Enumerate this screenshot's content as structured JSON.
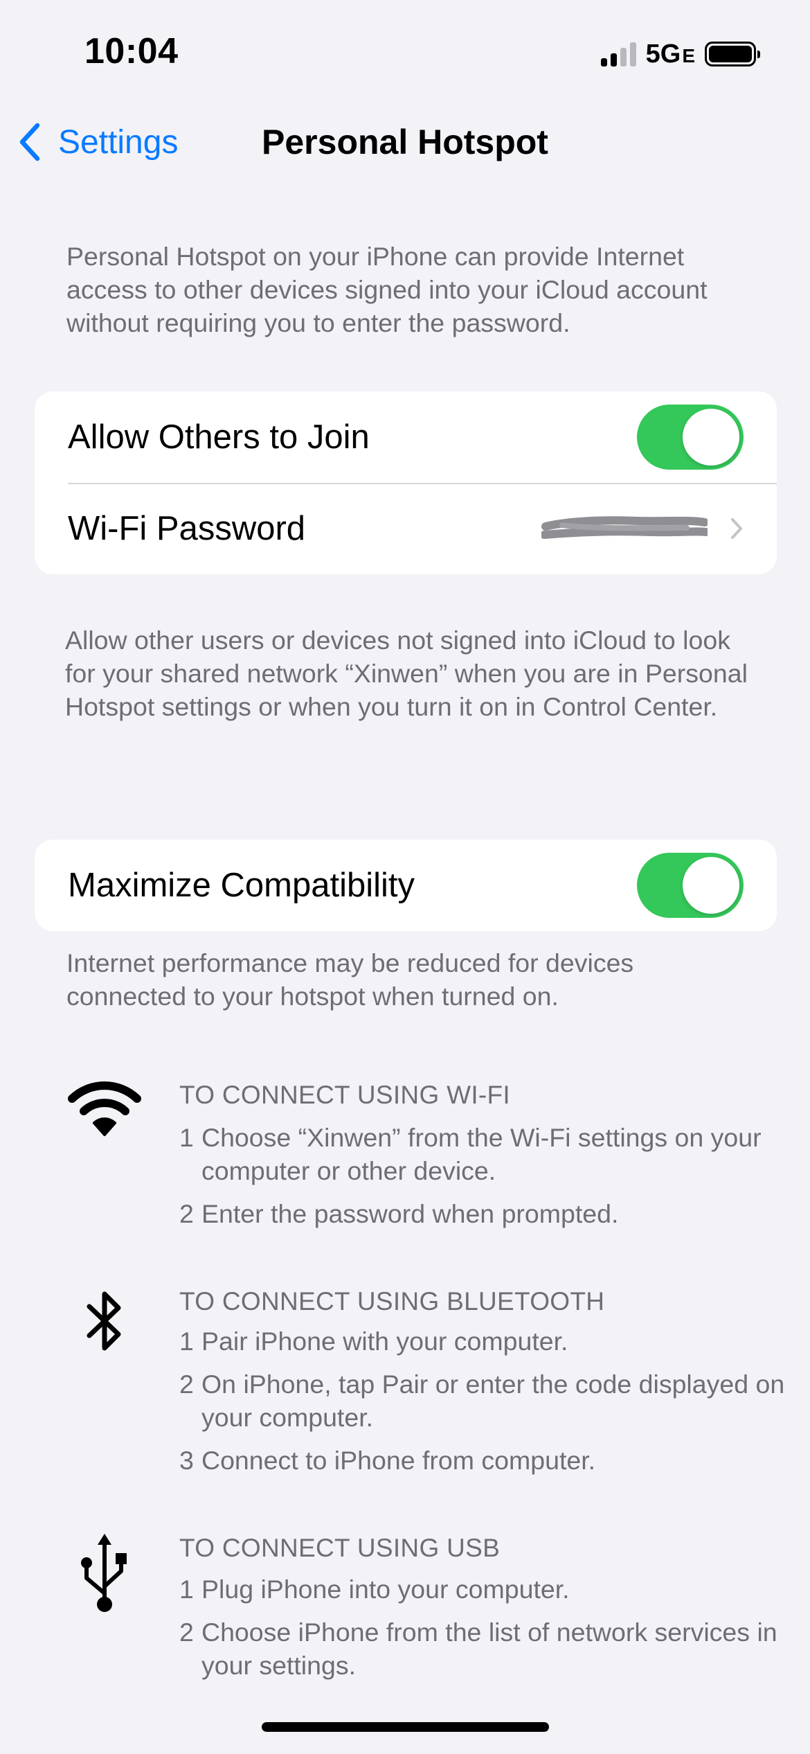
{
  "status_bar": {
    "time": "10:04",
    "network": "5G",
    "network_suffix": "E",
    "signal_bars_active": 2,
    "signal_bars_total": 4,
    "battery_level": 1.0
  },
  "nav": {
    "back_label": "Settings",
    "title": "Personal Hotspot"
  },
  "intro_text": "Personal Hotspot on your iPhone can provide Internet access to other devices signed into your iCloud account without requiring you to enter the password.",
  "group1": {
    "allow_join_label": "Allow Others to Join",
    "allow_join_on": true,
    "wifi_password_label": "Wi-Fi Password"
  },
  "allow_note": "Allow other users or devices not signed into iCloud to look for your shared network “Xinwen” when you are in Personal Hotspot settings or when you turn it on in Control Center.",
  "group2": {
    "max_compat_label": "Maximize Compatibility",
    "max_compat_on": true
  },
  "compat_note": "Internet performance may be reduced for devices connected to your hotspot when turned on.",
  "connect": {
    "wifi": {
      "heading": "TO CONNECT USING WI-FI",
      "steps": [
        {
          "num": "1",
          "text": "Choose “Xinwen” from the Wi-Fi settings on your computer or other device."
        },
        {
          "num": "2",
          "text": "Enter the password when prompted."
        }
      ]
    },
    "bluetooth": {
      "heading": "TO CONNECT USING BLUETOOTH",
      "steps": [
        {
          "num": "1",
          "text": "Pair iPhone with your computer."
        },
        {
          "num": "2",
          "text": "On iPhone, tap Pair or enter the code displayed on your computer."
        },
        {
          "num": "3",
          "text": "Connect to iPhone from computer."
        }
      ]
    },
    "usb": {
      "heading": "TO CONNECT USING USB",
      "steps": [
        {
          "num": "1",
          "text": "Plug iPhone into your computer."
        },
        {
          "num": "2",
          "text": "Choose iPhone from the list of network services in your settings."
        }
      ]
    }
  },
  "colors": {
    "accent": "#0a7aff",
    "toggle_on": "#34c759",
    "background": "#f2f2f7",
    "secondary_text": "#6d6d72"
  },
  "icons": {
    "wifi": "wifi-icon",
    "bluetooth": "bluetooth-icon",
    "usb": "usb-icon",
    "back": "chevron-left-icon",
    "disclosure": "chevron-right-icon"
  }
}
